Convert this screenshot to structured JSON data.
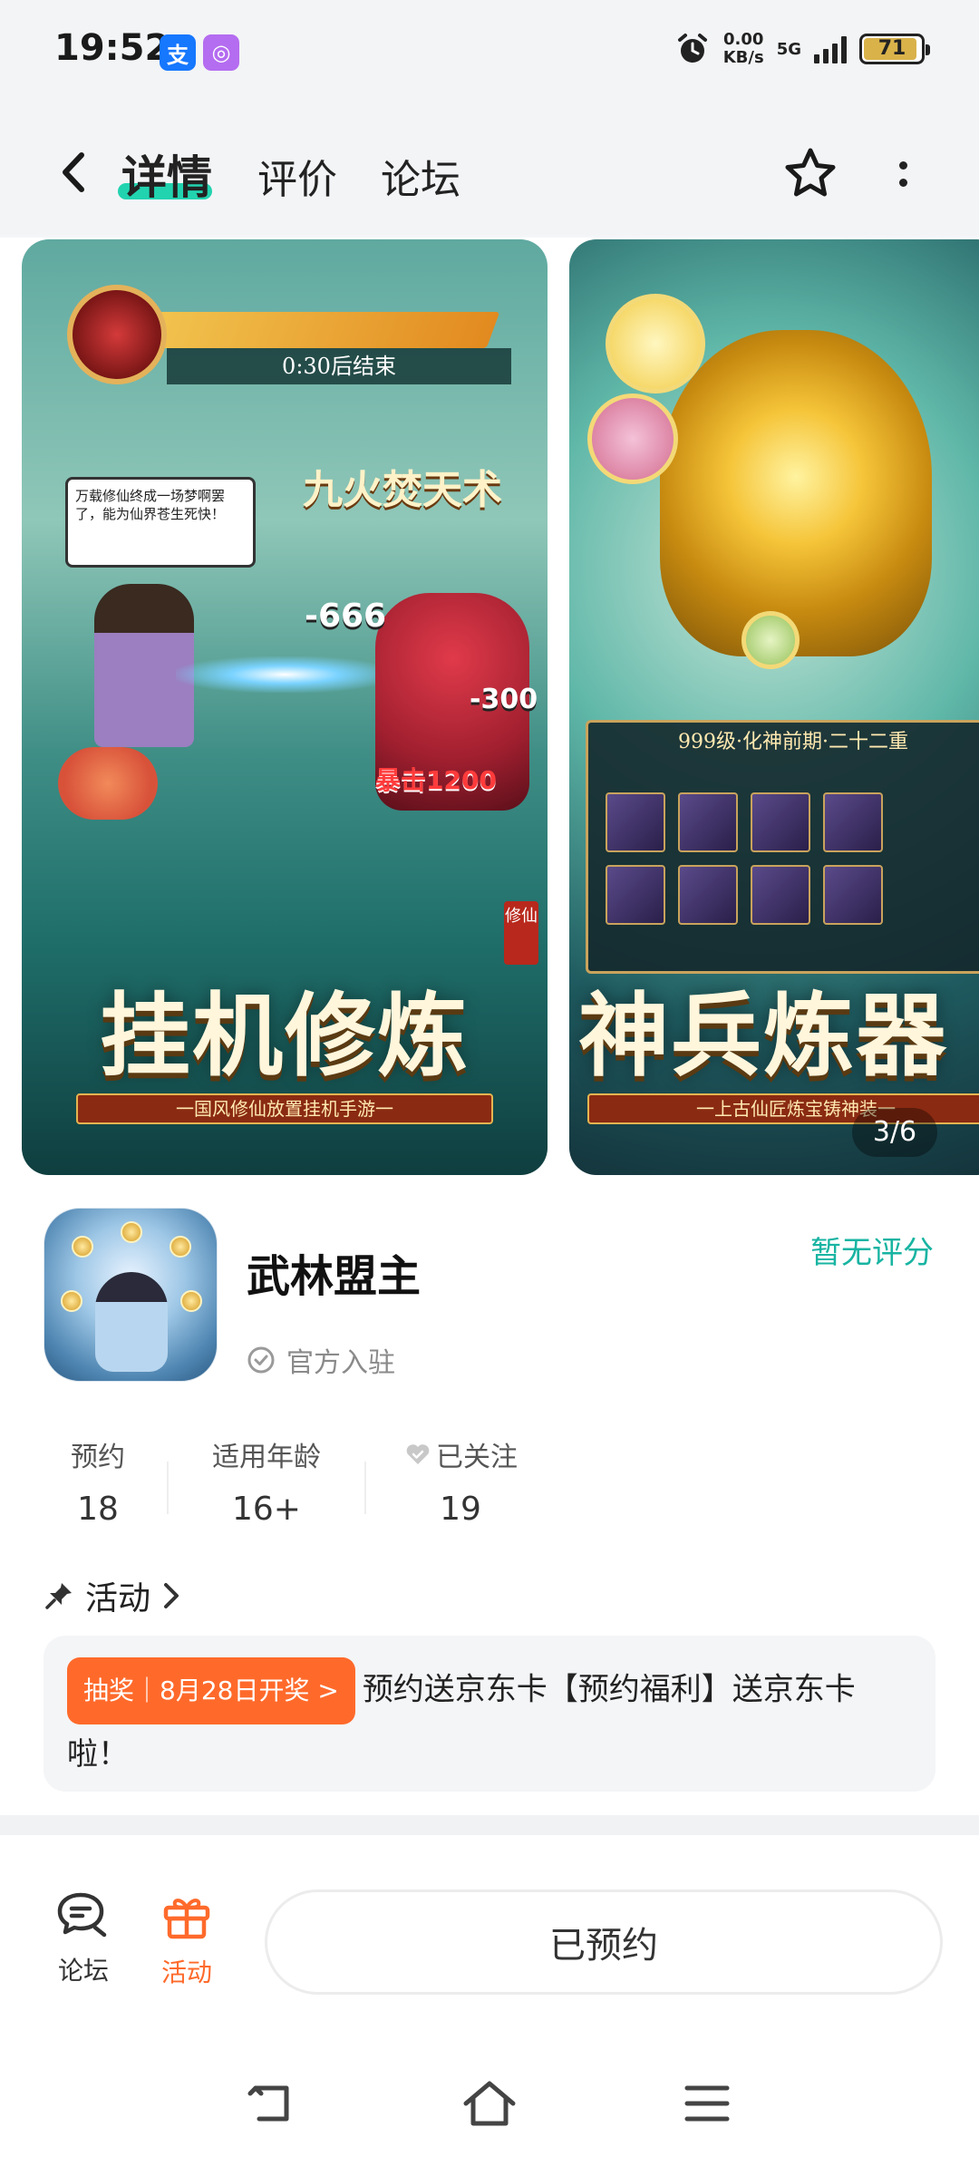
{
  "status_bar": {
    "time": "19:52",
    "app_icons": [
      "alipay-icon",
      "purple-app-icon"
    ],
    "net_speed_value": "0.00",
    "net_speed_unit": "KB/s",
    "network": "5G",
    "battery": "71"
  },
  "nav": {
    "tabs": [
      {
        "label": "详情",
        "active": true
      },
      {
        "label": "评价",
        "active": false
      },
      {
        "label": "论坛",
        "active": false
      }
    ],
    "accent": "#22d3b0"
  },
  "gallery": {
    "shot1": {
      "timer": "0:30后结束",
      "dialog": "万载修仙终成一场梦啊罢了，能为仙界苍生死快！",
      "skill": "九火焚天术",
      "dmg1": "-666",
      "dmg2": "-300",
      "dmg3": "暴击1200",
      "tag": "修仙",
      "caption": "挂机修炼",
      "subtitle": "一国风修仙放置挂机手游一"
    },
    "shot2": {
      "panel_title": "999级·化神前期·二十二重",
      "caption": "神兵炼器",
      "subtitle": "一上古仙匠炼宝铸神装一"
    },
    "page_indicator": "3/6"
  },
  "app": {
    "name": "武林盟主",
    "verified_label": "官方入驻",
    "rating": "暂无评分",
    "rating_color": "#18b4a2"
  },
  "stats": [
    {
      "label": "预约",
      "value": "18"
    },
    {
      "label": "适用年龄",
      "value": "16+"
    },
    {
      "label": "已关注",
      "value": "19"
    }
  ],
  "activity": {
    "heading": "活动",
    "chip": "抽奖｜8月28日开奖 >",
    "text": "预约送京东卡【预约福利】送京东卡啦！",
    "chip_color": "#ff6a2b"
  },
  "bottom_bar": {
    "forum_label": "论坛",
    "activity_label": "活动",
    "activity_color": "#ff6a2b",
    "reserve_label": "已预约"
  }
}
